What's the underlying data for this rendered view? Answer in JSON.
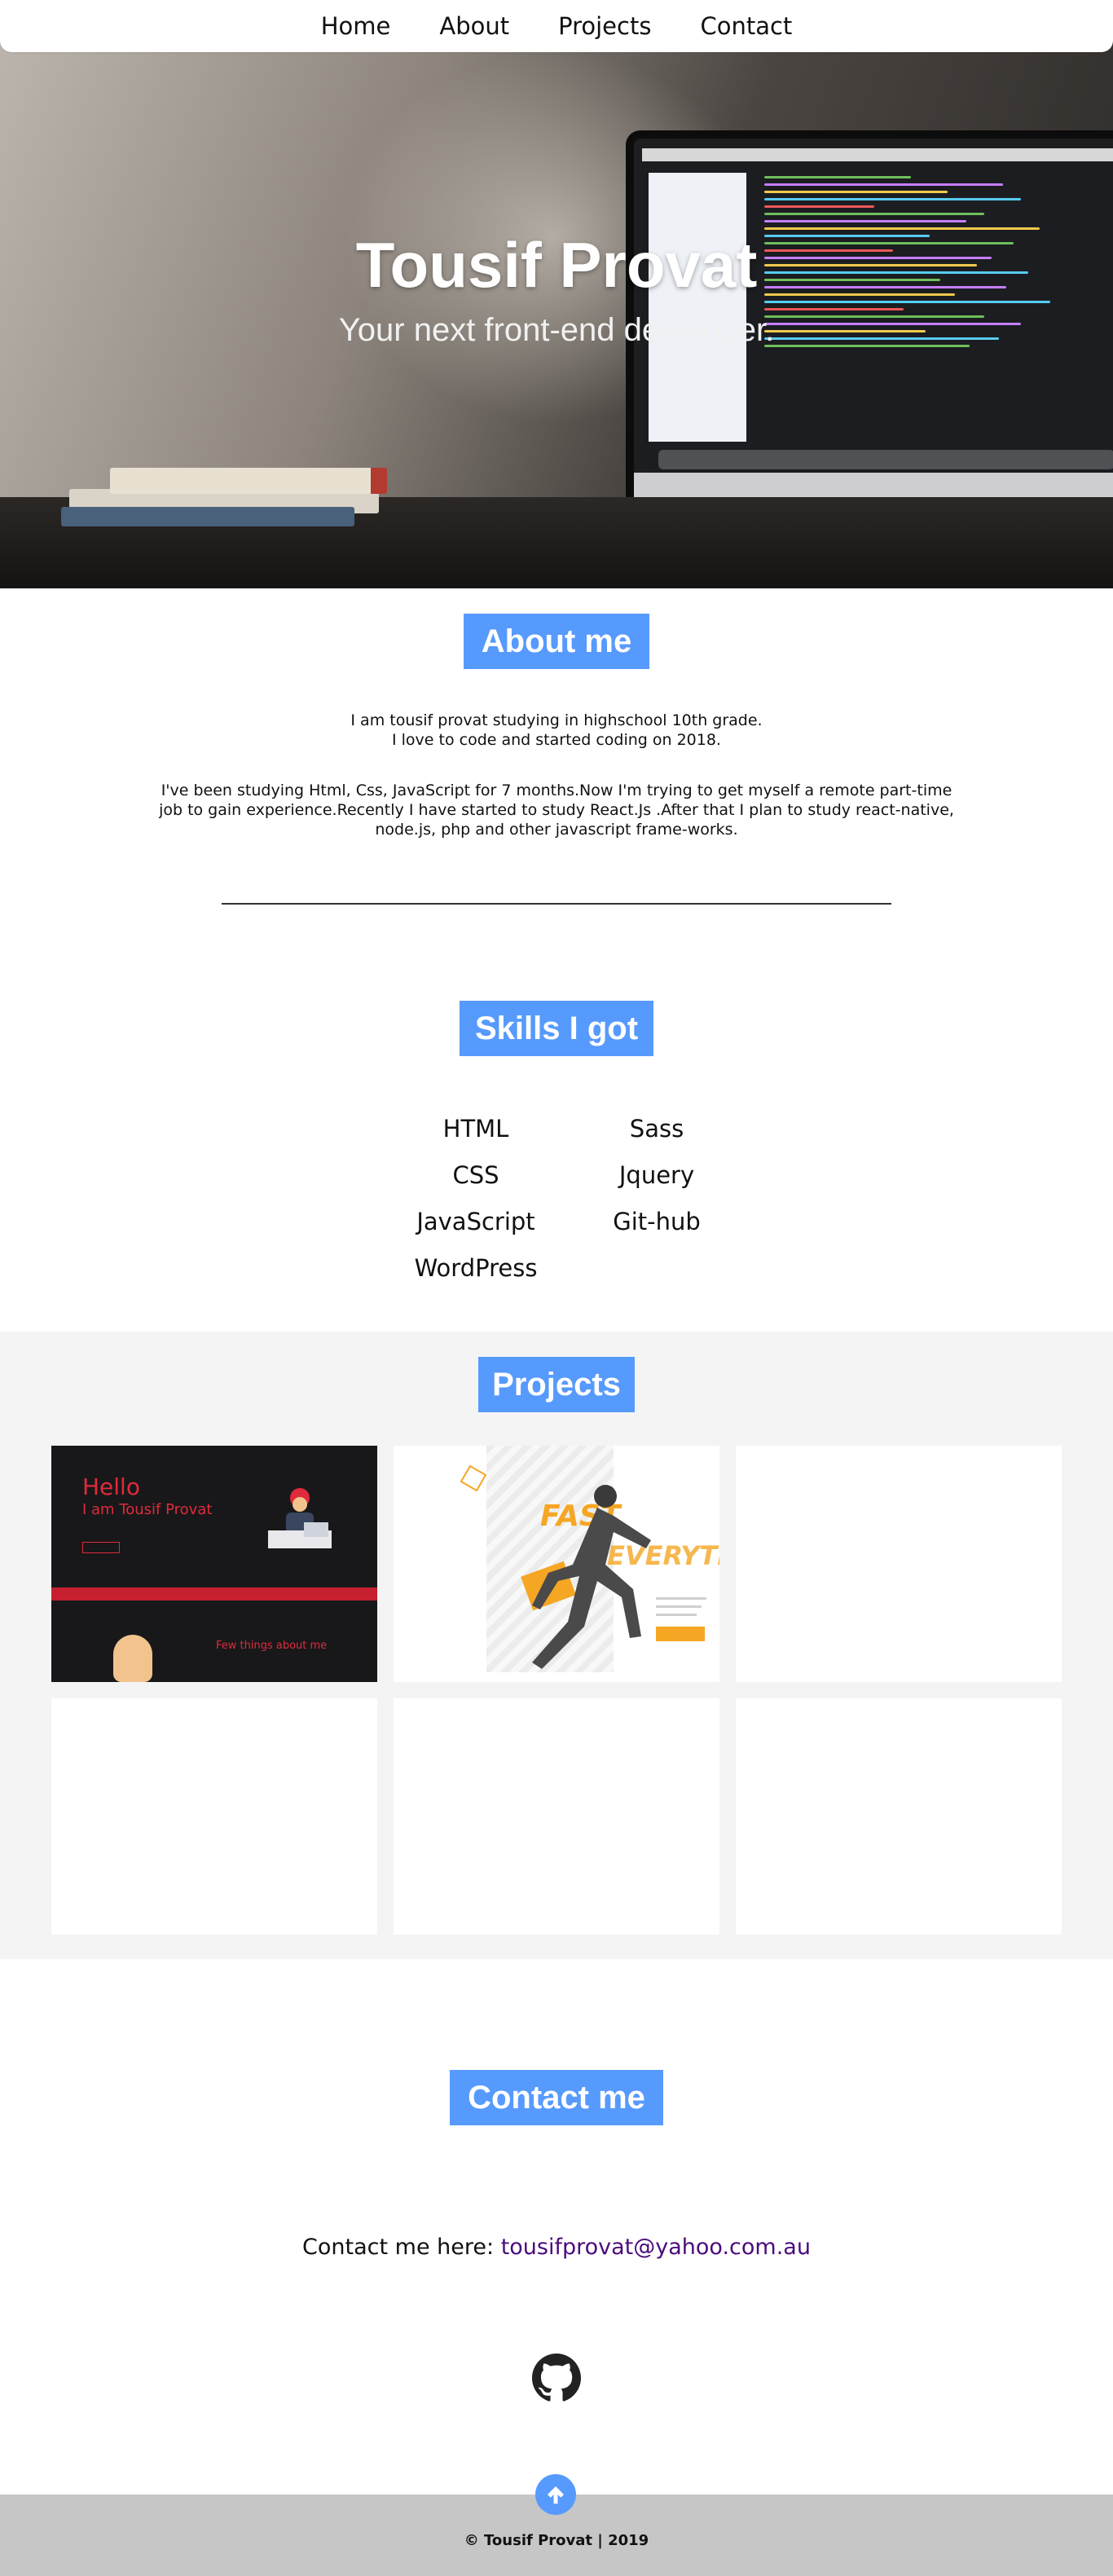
{
  "nav": {
    "items": [
      "Home",
      "About",
      "Projects",
      "Contact"
    ]
  },
  "hero": {
    "title": "Tousif Provat",
    "subtitle": "Your next front-end developer."
  },
  "about": {
    "heading": "About me",
    "line1": "I am tousif provat studying in highschool 10th grade.",
    "line2": "I love to code and started coding on 2018.",
    "line3": "I've been studying Html, Css, JavaScript for 7 months.Now I'm trying to get myself a remote part-time",
    "line4": "job to gain experience.Recently I have started to study React.Js .After that I plan to study react-native,",
    "line5": "node.js, php and other javascript frame-works."
  },
  "skills": {
    "heading": "Skills I got",
    "items": [
      "HTML",
      "Sass",
      "CSS",
      "Jquery",
      "JavaScript",
      "Git-hub",
      "WordPress"
    ]
  },
  "projects": {
    "heading": "Projects",
    "card1": {
      "hello": "Hello",
      "iam": "I am Tousif Provat",
      "few": "Few things about me"
    },
    "card2": {
      "fast": "FAST",
      "every": "EVERYTHIN"
    }
  },
  "contact": {
    "heading": "Contact me",
    "label": "Contact me here: ",
    "email": "tousifprovat@yahoo.com.au"
  },
  "footer": {
    "text": "© Tousif Provat | 2019"
  },
  "colors": {
    "accent": "#579afd",
    "link": "#4b0b7c",
    "footer_bg": "#c6c6c6",
    "projects_bg": "#f4f4f4"
  },
  "icons": {
    "github": "github-icon",
    "scroll_top": "arrow-up-icon"
  }
}
